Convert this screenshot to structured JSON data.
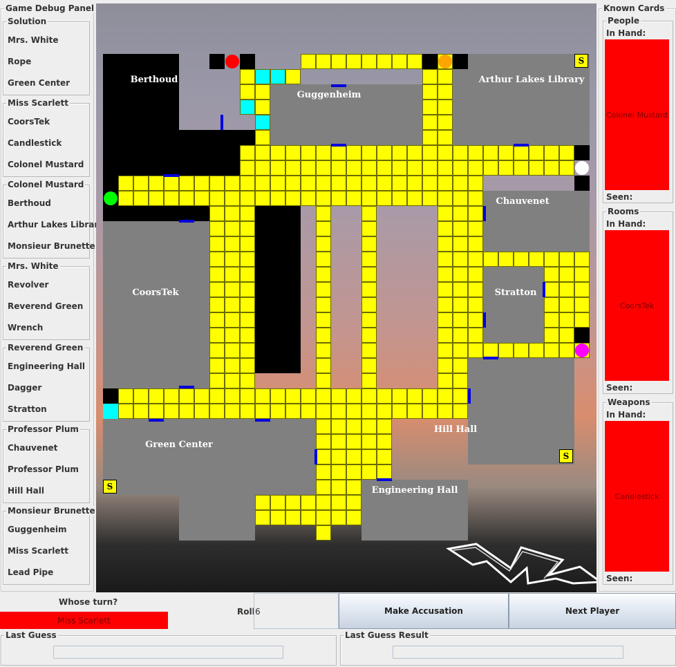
{
  "debug_panel": {
    "title": "Game Debug Panel",
    "sections": [
      {
        "title": "Solution",
        "items": [
          "Mrs. White",
          "Rope",
          "Green Center"
        ]
      },
      {
        "title": "Miss Scarlett",
        "items": [
          "CoorsTek",
          "Candlestick",
          "Colonel Mustard"
        ]
      },
      {
        "title": "Colonel Mustard",
        "items": [
          "Berthoud",
          "Arthur Lakes Library",
          "Monsieur Brunette"
        ]
      },
      {
        "title": "Mrs. White",
        "items": [
          "Revolver",
          "Reverend Green",
          "Wrench"
        ]
      },
      {
        "title": "Reverend Green",
        "items": [
          "Engineering Hall",
          "Dagger",
          "Stratton"
        ]
      },
      {
        "title": "Professor Plum",
        "items": [
          "Chauvenet",
          "Professor Plum",
          "Hill Hall"
        ]
      },
      {
        "title": "Monsieur Brunette",
        "items": [
          "Guggenheim",
          "Miss Scarlett",
          "Lead Pipe"
        ]
      }
    ]
  },
  "board": {
    "rooms": {
      "berthoud": "Berthoud",
      "guggenheim": "Guggenheim",
      "arthur_lakes_library": "Arthur Lakes Library",
      "chauvenet": "Chauvenet",
      "coorstek": "CoorsTek",
      "stratton": "Stratton",
      "hill_hall": "Hill Hall",
      "green_center": "Green Center",
      "engineering_hall": "Engineering Hall"
    },
    "secret_passage_label": "S",
    "player_colors": {
      "scarlett": "#ff0000",
      "mustard": "#ffa500",
      "white": "#ffffff",
      "green": "#00ff00",
      "plum": "#ff00ff"
    },
    "colors": {
      "hallway": "#ffff00",
      "room": "#808080",
      "door": "#0000dd",
      "berthoud_floor": "#00ffff"
    }
  },
  "known_cards": {
    "title": "Known Cards",
    "groups": [
      {
        "title": "People",
        "in_hand_label": "In Hand:",
        "card": "Colonel Mustard",
        "seen_label": "Seen:"
      },
      {
        "title": "Rooms",
        "in_hand_label": "In Hand:",
        "card": "CoorsTek",
        "seen_label": "Seen:"
      },
      {
        "title": "Weapons",
        "in_hand_label": "In Hand:",
        "card": "Candlestick",
        "seen_label": "Seen:"
      }
    ]
  },
  "controls": {
    "whose_turn_label": "Whose turn?",
    "current_player": "Miss Scarlett",
    "current_player_color": "#ff0000",
    "roll_label": "Roll:",
    "roll_value": "6",
    "accuse_button": "Make Accusation",
    "next_button": "Next Player",
    "last_guess_label": "Last Guess",
    "last_guess_result_label": "Last Guess Result"
  }
}
